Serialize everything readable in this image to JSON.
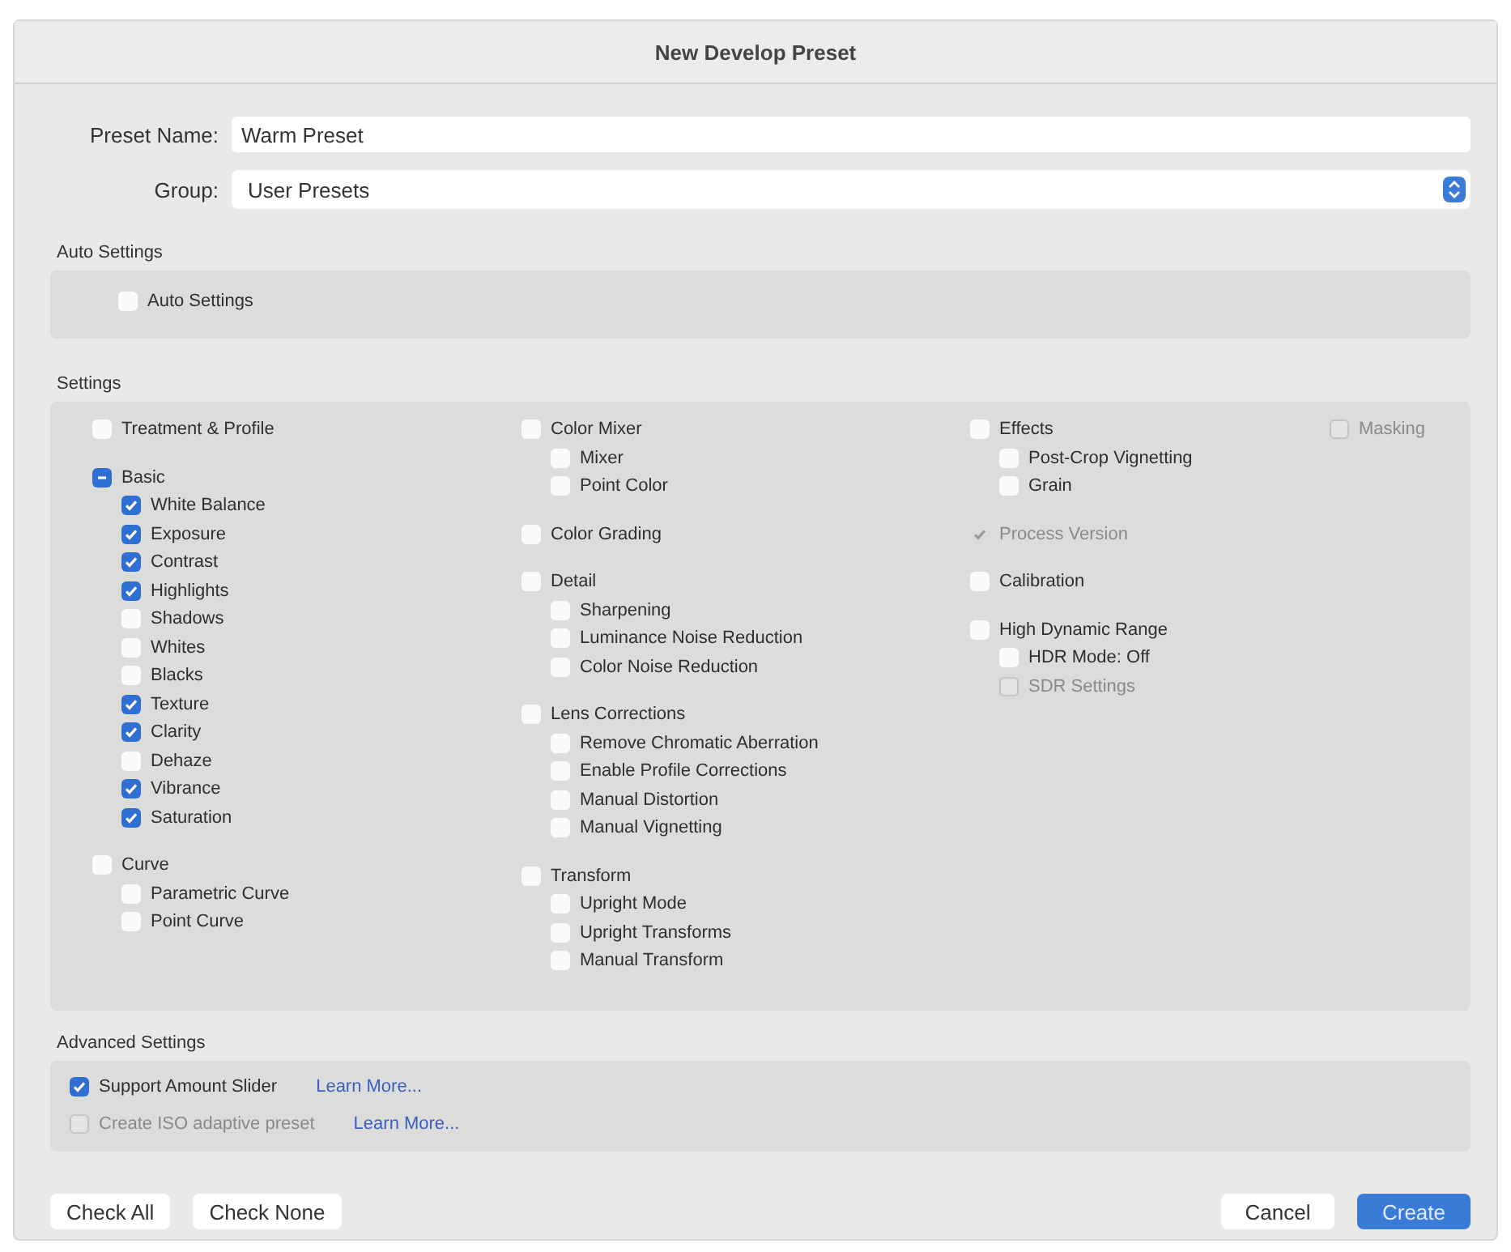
{
  "window": {
    "title": "New Develop Preset"
  },
  "preset_name": {
    "label": "Preset Name:",
    "value": "Warm Preset"
  },
  "group": {
    "label": "Group:",
    "value": "User Presets"
  },
  "auto_settings": {
    "title": "Auto Settings",
    "items": [
      {
        "label": "Auto Settings",
        "checked": false,
        "disabled": false
      }
    ]
  },
  "settings": {
    "title": "Settings",
    "columns": [
      [
        {
          "label": "Treatment & Profile",
          "checked": false,
          "disabled": false
        },
        {
          "label": "Basic",
          "checked": true,
          "disabled": false,
          "children": [
            {
              "label": "White Balance",
              "checked": true,
              "disabled": false
            },
            {
              "label": "Exposure",
              "checked": true,
              "disabled": false
            },
            {
              "label": "Contrast",
              "checked": true,
              "disabled": false
            },
            {
              "label": "Highlights",
              "checked": true,
              "disabled": false
            },
            {
              "label": "Shadows",
              "checked": false,
              "disabled": false
            },
            {
              "label": "Whites",
              "checked": false,
              "disabled": false
            },
            {
              "label": "Blacks",
              "checked": false,
              "disabled": false
            },
            {
              "label": "Texture",
              "checked": true,
              "disabled": false
            },
            {
              "label": "Clarity",
              "checked": true,
              "disabled": false
            },
            {
              "label": "Dehaze",
              "checked": false,
              "disabled": false
            },
            {
              "label": "Vibrance",
              "checked": true,
              "disabled": false
            },
            {
              "label": "Saturation",
              "checked": true,
              "disabled": false
            }
          ]
        },
        {
          "label": "Curve",
          "checked": false,
          "disabled": false,
          "children": [
            {
              "label": "Parametric Curve",
              "checked": false,
              "disabled": false
            },
            {
              "label": "Point Curve",
              "checked": false,
              "disabled": false
            }
          ]
        }
      ],
      [
        {
          "label": "Color Mixer",
          "checked": false,
          "disabled": false,
          "children": [
            {
              "label": "Mixer",
              "checked": false,
              "disabled": false
            },
            {
              "label": "Point Color",
              "checked": false,
              "disabled": false
            }
          ]
        },
        {
          "label": "Color Grading",
          "checked": false,
          "disabled": false
        },
        {
          "label": "Detail",
          "checked": false,
          "disabled": false,
          "children": [
            {
              "label": "Sharpening",
              "checked": false,
              "disabled": false
            },
            {
              "label": "Luminance Noise Reduction",
              "checked": false,
              "disabled": false
            },
            {
              "label": "Color Noise Reduction",
              "checked": false,
              "disabled": false
            }
          ]
        },
        {
          "label": "Lens Corrections",
          "checked": false,
          "disabled": false,
          "children": [
            {
              "label": "Remove Chromatic Aberration",
              "checked": false,
              "disabled": false
            },
            {
              "label": "Enable Profile Corrections",
              "checked": false,
              "disabled": false
            },
            {
              "label": "Manual Distortion",
              "checked": false,
              "disabled": false
            },
            {
              "label": "Manual Vignetting",
              "checked": false,
              "disabled": false
            }
          ]
        },
        {
          "label": "Transform",
          "checked": false,
          "disabled": false,
          "children": [
            {
              "label": "Upright Mode",
              "checked": false,
              "disabled": false
            },
            {
              "label": "Upright Transforms",
              "checked": false,
              "disabled": false
            },
            {
              "label": "Manual Transform",
              "checked": false,
              "disabled": false
            }
          ]
        }
      ],
      [
        {
          "label": "Effects",
          "checked": false,
          "disabled": false,
          "children": [
            {
              "label": "Post-Crop Vignetting",
              "checked": false,
              "disabled": false
            },
            {
              "label": "Grain",
              "checked": false,
              "disabled": false
            }
          ]
        },
        {
          "label": "Process Version",
          "checked": true,
          "disabled": true
        },
        {
          "label": "Calibration",
          "checked": false,
          "disabled": false
        },
        {
          "label": "High Dynamic Range",
          "checked": false,
          "disabled": false,
          "children": [
            {
              "label": "HDR Mode: Off",
              "checked": false,
              "disabled": false
            },
            {
              "label": "SDR Settings",
              "checked": false,
              "disabled": true
            }
          ]
        }
      ],
      [
        {
          "label": "Masking",
          "checked": false,
          "disabled": true
        }
      ]
    ]
  },
  "advanced_settings": {
    "title": "Advanced Settings",
    "items": [
      {
        "label": "Support Amount Slider",
        "checked": true,
        "disabled": false,
        "link": "Learn More..."
      },
      {
        "label": "Create ISO adaptive preset",
        "checked": false,
        "disabled": true,
        "link": "Learn More..."
      }
    ]
  },
  "buttons_left": [
    "Check All",
    "Check None"
  ],
  "buttons_right": [
    {
      "label": "Cancel",
      "primary": false
    },
    {
      "label": "Create",
      "primary": true
    }
  ]
}
